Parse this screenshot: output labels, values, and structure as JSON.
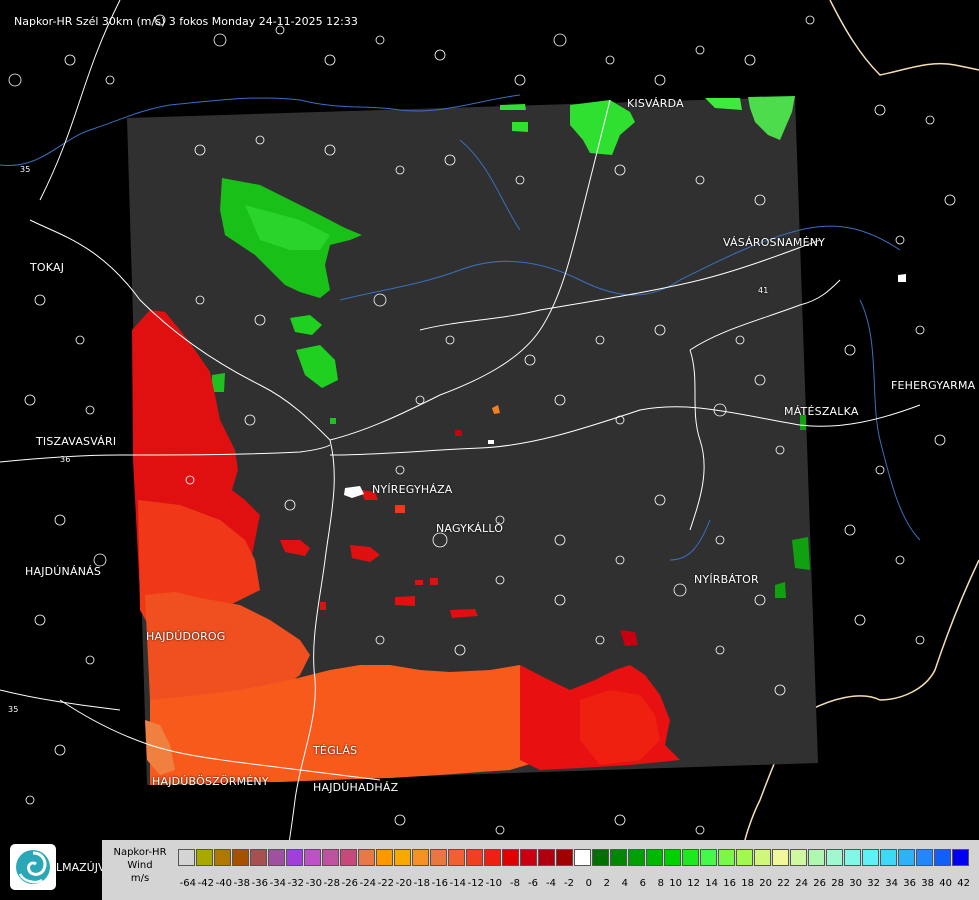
{
  "title": "Napkor-HR Szél 30km (m/s) 3 fokos Monday 24-11-2025 12:33",
  "places": {
    "kisvarda": "KISVÁRDA",
    "tokaj": "TOKAJ",
    "vasarosnameny": "VÁSÁROSNAMÉNY",
    "fehergyarmat": "FEHERGYARMA",
    "mateszalka": "MÁTÉSZALKA",
    "tiszavasvari": "TISZAVASVÁRI",
    "nyiregyhaza": "NYÍREGYHÁZA",
    "nagykallo": "NAGYKÁLLÓ",
    "hajdunanas": "HAJDÚNÁNÁS",
    "nyirbator": "NYÍRBÁTOR",
    "hajdudorog": "HAJDÚDOROG",
    "teglas": "TÉGLÁS",
    "hajduboszormeny": "HAJDÚBÖSZÖRMÉNY",
    "hajduhadhaz": "HAJDÚHADHÁZ",
    "balmazujvaros_fragment": "LMAZÚJVÁR"
  },
  "road_numbers": {
    "r35_top": "35",
    "r41": "41",
    "r36": "36",
    "r35_bottom": "35"
  },
  "legend": {
    "label_line1": "Napkor-HR",
    "label_line2": "Wind",
    "label_line3": "m/s",
    "ticks": [
      "-64",
      "-42",
      "-40",
      "-38",
      "-36",
      "-34",
      "-32",
      "-30",
      "-28",
      "-26",
      "-24",
      "-22",
      "-20",
      "-18",
      "-16",
      "-14",
      "-12",
      "-10",
      "-8",
      "-6",
      "-4",
      "-2",
      "0",
      "2",
      "4",
      "6",
      "8",
      "10",
      "12",
      "14",
      "16",
      "18",
      "20",
      "22",
      "24",
      "26",
      "28",
      "30",
      "32",
      "34",
      "36",
      "38",
      "40",
      "42"
    ],
    "colors": [
      "#d4d4d4",
      "#a8a800",
      "#b07800",
      "#a85000",
      "#a85050",
      "#a050a0",
      "#a040d8",
      "#c050c8",
      "#c050a0",
      "#c84878",
      "#e87848",
      "#ff9800",
      "#f8a800",
      "#f89028",
      "#e87840",
      "#f06030",
      "#f04020",
      "#f02010",
      "#e00000",
      "#c80010",
      "#b00010",
      "#a00000",
      "#ffffff",
      "#007000",
      "#008800",
      "#00a000",
      "#00b800",
      "#00d000",
      "#20e820",
      "#48f848",
      "#78f848",
      "#a0f850",
      "#d0f878",
      "#f0f898",
      "#d0f8a0",
      "#b0f8b0",
      "#a0f8d0",
      "#80f8e8",
      "#60f0f8",
      "#40d8f8",
      "#30b0f8",
      "#2088f8",
      "#1060f8",
      "#0000f0"
    ]
  },
  "colors": {
    "background": "#000000",
    "radar_area": "#303030",
    "border": "#f5deb3",
    "roads": "#ffffff",
    "rivers": "#3a6fbf"
  },
  "icons": {
    "logo": "napkor-swirl-logo-icon"
  }
}
